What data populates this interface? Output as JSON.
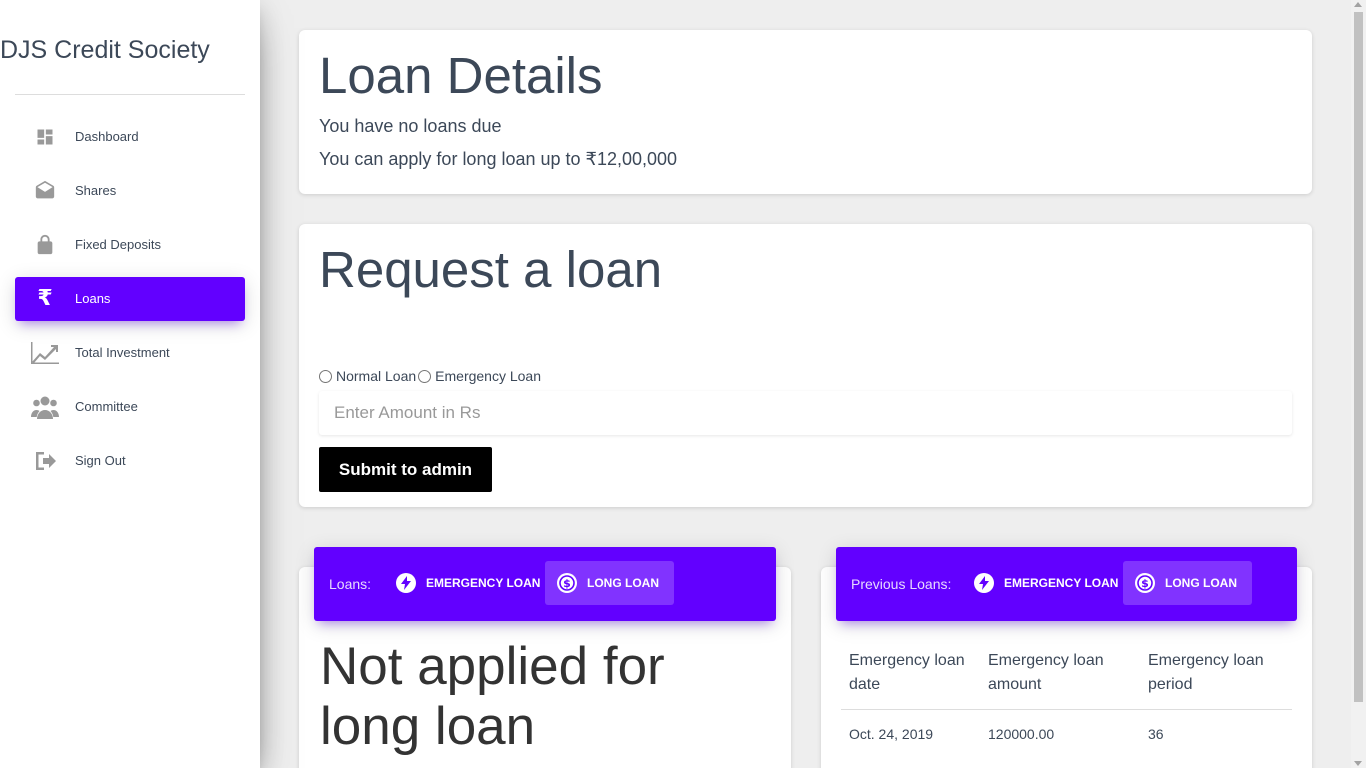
{
  "sidebar": {
    "brand": "DJS Credit Society",
    "items": [
      {
        "label": "Dashboard",
        "icon": "dashboard-icon"
      },
      {
        "label": "Shares",
        "icon": "drafts-icon"
      },
      {
        "label": "Fixed Deposits",
        "icon": "lock-icon"
      },
      {
        "label": "Loans",
        "icon": "rupee-icon",
        "active": true
      },
      {
        "label": "Total Investment",
        "icon": "trending-up-icon"
      },
      {
        "label": "Committee",
        "icon": "group-icon"
      },
      {
        "label": "Sign Out",
        "icon": "sign-out-icon"
      }
    ]
  },
  "loan_details": {
    "title": "Loan Details",
    "due_text": "You have no loans due",
    "limit_text": "You can apply for long loan up to ₹12,00,000"
  },
  "request": {
    "title": "Request a loan",
    "option_normal": "Normal Loan",
    "option_emergency": "Emergency Loan",
    "amount_placeholder": "Enter Amount in Rs",
    "submit_label": "Submit to admin"
  },
  "loans_card": {
    "title": "Loans:",
    "tab_emergency": "EMERGENCY LOAN",
    "tab_long": "LONG LOAN",
    "message": "Not applied for long loan"
  },
  "previous_card": {
    "title": "Previous Loans:",
    "tab_emergency": "EMERGENCY LOAN",
    "tab_long": "LONG LOAN",
    "columns": [
      "Emergency loan date",
      "Emergency loan amount",
      "Emergency loan period"
    ],
    "rows": [
      [
        "Oct. 24, 2019",
        "120000.00",
        "36"
      ]
    ]
  },
  "colors": {
    "accent": "#6200ff",
    "text": "#3c4858"
  }
}
